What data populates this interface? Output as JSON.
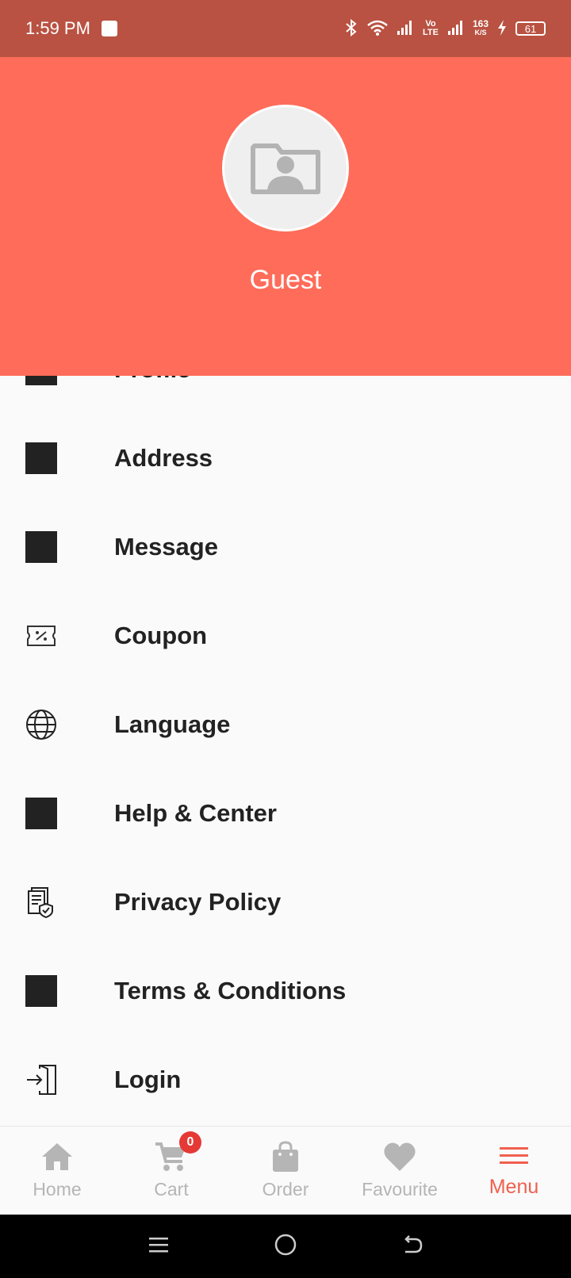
{
  "status_bar": {
    "time": "1:59 PM",
    "speed_value": "163",
    "speed_unit": "K/S",
    "volte": "Vo LTE",
    "battery": "61"
  },
  "profile": {
    "name": "Guest"
  },
  "menu": {
    "items": [
      {
        "label": "Profile",
        "icon": "profile-icon"
      },
      {
        "label": "Address",
        "icon": "address-icon"
      },
      {
        "label": "Message",
        "icon": "message-icon"
      },
      {
        "label": "Coupon",
        "icon": "coupon-icon"
      },
      {
        "label": "Language",
        "icon": "globe-icon"
      },
      {
        "label": "Help & Center",
        "icon": "help-icon"
      },
      {
        "label": "Privacy Policy",
        "icon": "privacy-policy-icon"
      },
      {
        "label": "Terms & Conditions",
        "icon": "terms-icon"
      },
      {
        "label": "Login",
        "icon": "login-icon"
      }
    ]
  },
  "bottom_nav": {
    "items": [
      {
        "label": "Home",
        "icon": "home-icon"
      },
      {
        "label": "Cart",
        "icon": "cart-icon",
        "badge": "0"
      },
      {
        "label": "Order",
        "icon": "bag-icon"
      },
      {
        "label": "Favourite",
        "icon": "heart-icon"
      },
      {
        "label": "Menu",
        "icon": "menu-icon"
      }
    ],
    "active": "Menu"
  },
  "colors": {
    "status_bar": "#b95242",
    "header": "#ff6c59",
    "accent": "#f0604e",
    "badge": "#e53935"
  }
}
